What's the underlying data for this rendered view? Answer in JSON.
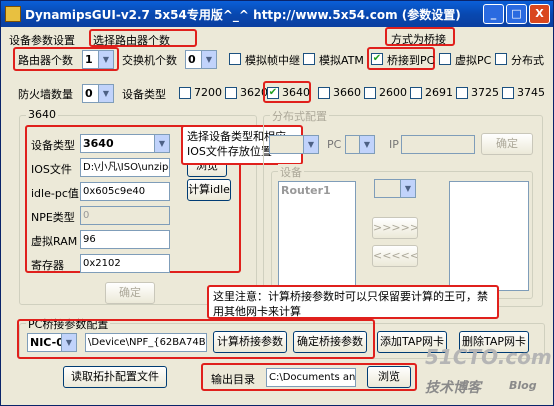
{
  "title": "DynamipsGUI-v2.7    5x54专用版^_^ http://www.5x54.com   (参数设置)",
  "window_buttons": [
    "_",
    "□",
    "X"
  ],
  "section_title": "设备参数设置",
  "hints": {
    "router_count": "选择路由器个数",
    "bridge": "方式为桥接",
    "device": "选择设备类型和相应IOS文件存放位置",
    "note": "这里注意：计算桥接参数时可以只保留要计算的王可，禁用其他网卡来计算"
  },
  "row1": {
    "router_count_label": "路由器个数",
    "router_count": "1",
    "switch_label": "交换机个数",
    "switch_count": "0",
    "frame_relay": "模拟帧中继",
    "atm": "模拟ATM",
    "bridge_pc": "桥接到PC",
    "virtual_pc": "虚拟PC",
    "distributed": "分布式"
  },
  "row2": {
    "firewall_label": "防火墙数量",
    "firewall_count": "0",
    "device_type_label": "设备类型",
    "types": [
      "7200",
      "3620",
      "3640",
      "3660",
      "2600",
      "2691",
      "3725",
      "3745"
    ]
  },
  "left_group": {
    "title": "3640",
    "device_type_label": "设备类型",
    "device_type": "3640",
    "ios_label": "IOS文件",
    "ios_value": "D:\\小凡\\ISO\\unzip-c",
    "browse": "浏览",
    "idlepc_label": "idle-pc值",
    "idlepc_value": "0x605c9e40",
    "calc_idle": "计算idle",
    "npe_label": "NPE类型",
    "npe_value": "0",
    "ram_label": "虚拟RAM",
    "ram_value": "96",
    "reg_label": "寄存器",
    "reg_value": "0x2102",
    "ok": "确定"
  },
  "dist_group": {
    "title": "分布式配置",
    "pc_label": "PC",
    "ip_label": "IP",
    "ok": "确定",
    "device_title": "设备",
    "device_item": "Router1",
    "right_btn": ">>>>>>",
    "left_btn": "<<<<<<"
  },
  "bridge_group": {
    "title": "PC桥接参数配置",
    "nic": "NIC-0",
    "device": "\\Device\\NPF_{62BA74BF-8",
    "calc": "计算桥接参数",
    "confirm": "确定桥接参数",
    "add_tap": "添加TAP网卡",
    "del_tap": "删除TAP网卡"
  },
  "bottom": {
    "read_topo": "读取拓扑配置文件",
    "output_label": "输出目录",
    "output_value": "C:\\Documents and",
    "browse": "浏览"
  },
  "watermark": {
    "site": "51CTO.com",
    "sub": "技术博客",
    "blog": "Blog"
  }
}
